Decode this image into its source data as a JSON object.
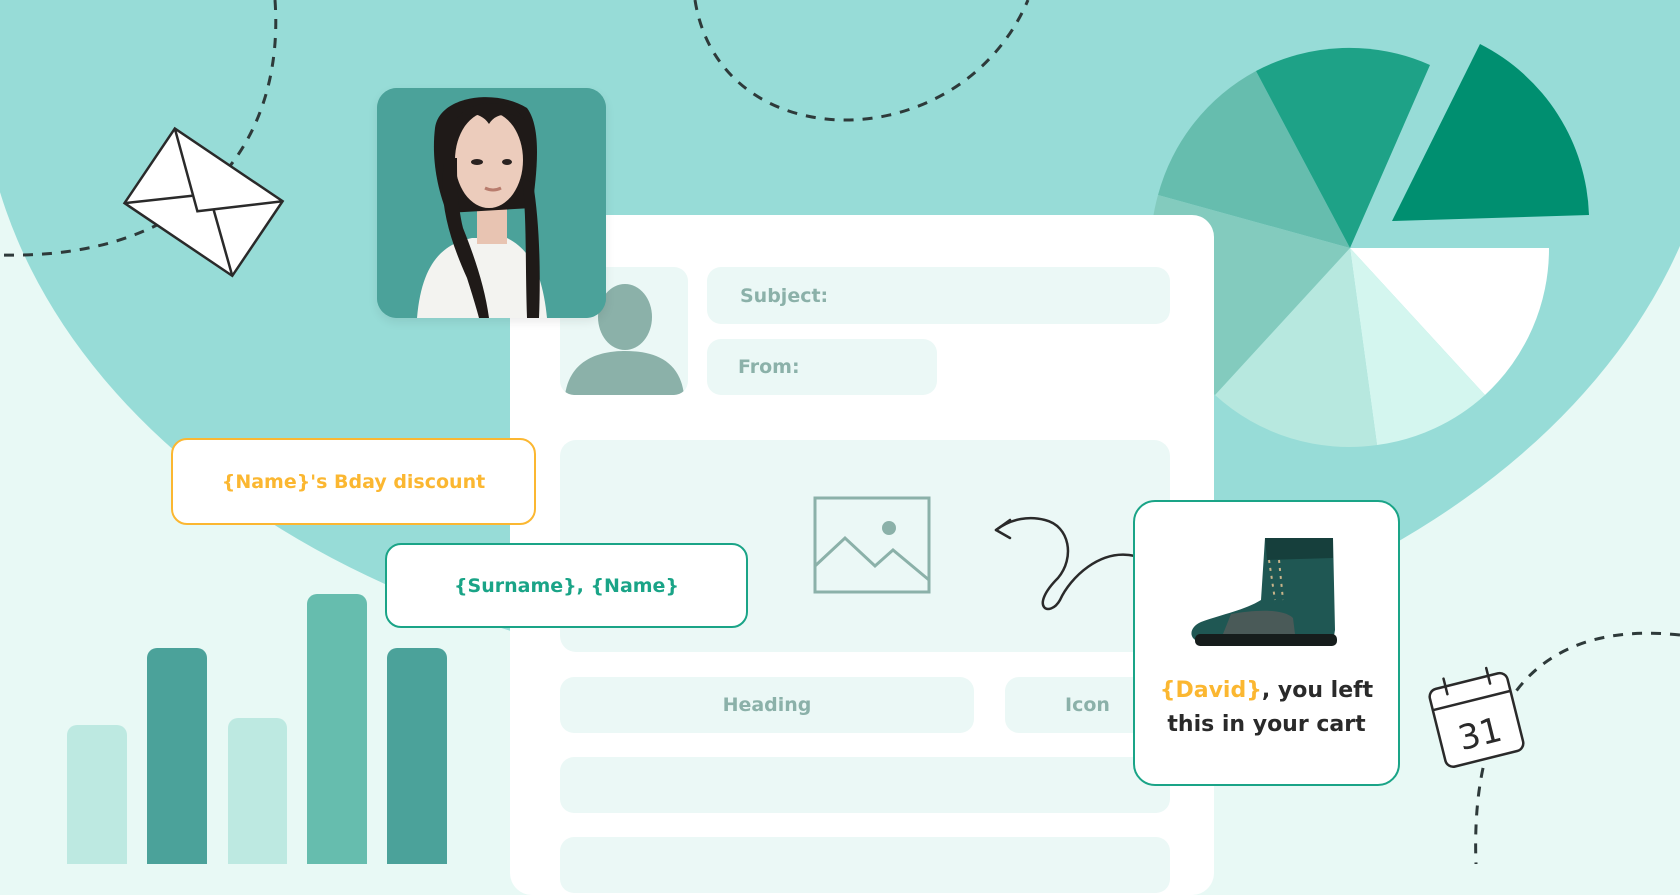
{
  "form": {
    "subject_label": "Subject:",
    "from_label": "From:",
    "heading_label": "Heading",
    "icon_label": "Icon"
  },
  "tags": {
    "bday_discount": "{Name}'s Bday discount",
    "surname_name": "{Surname}, {Name}"
  },
  "product_card": {
    "name_var": "{David}",
    "message": ", you left this in your cart"
  },
  "calendar": {
    "day": "31"
  },
  "icons": [
    "envelope-icon",
    "calendar-icon",
    "image-placeholder-icon",
    "avatar-silhouette-icon",
    "curly-arrow-icon",
    "boot-image"
  ],
  "colors": {
    "background_light": "#e8f9f5",
    "circle_teal": "#97dcd7",
    "accent_green": "#1aa487",
    "accent_orange": "#fbb731",
    "dark_teal": "#4ba29a",
    "field_bg": "#ebf8f6"
  }
}
